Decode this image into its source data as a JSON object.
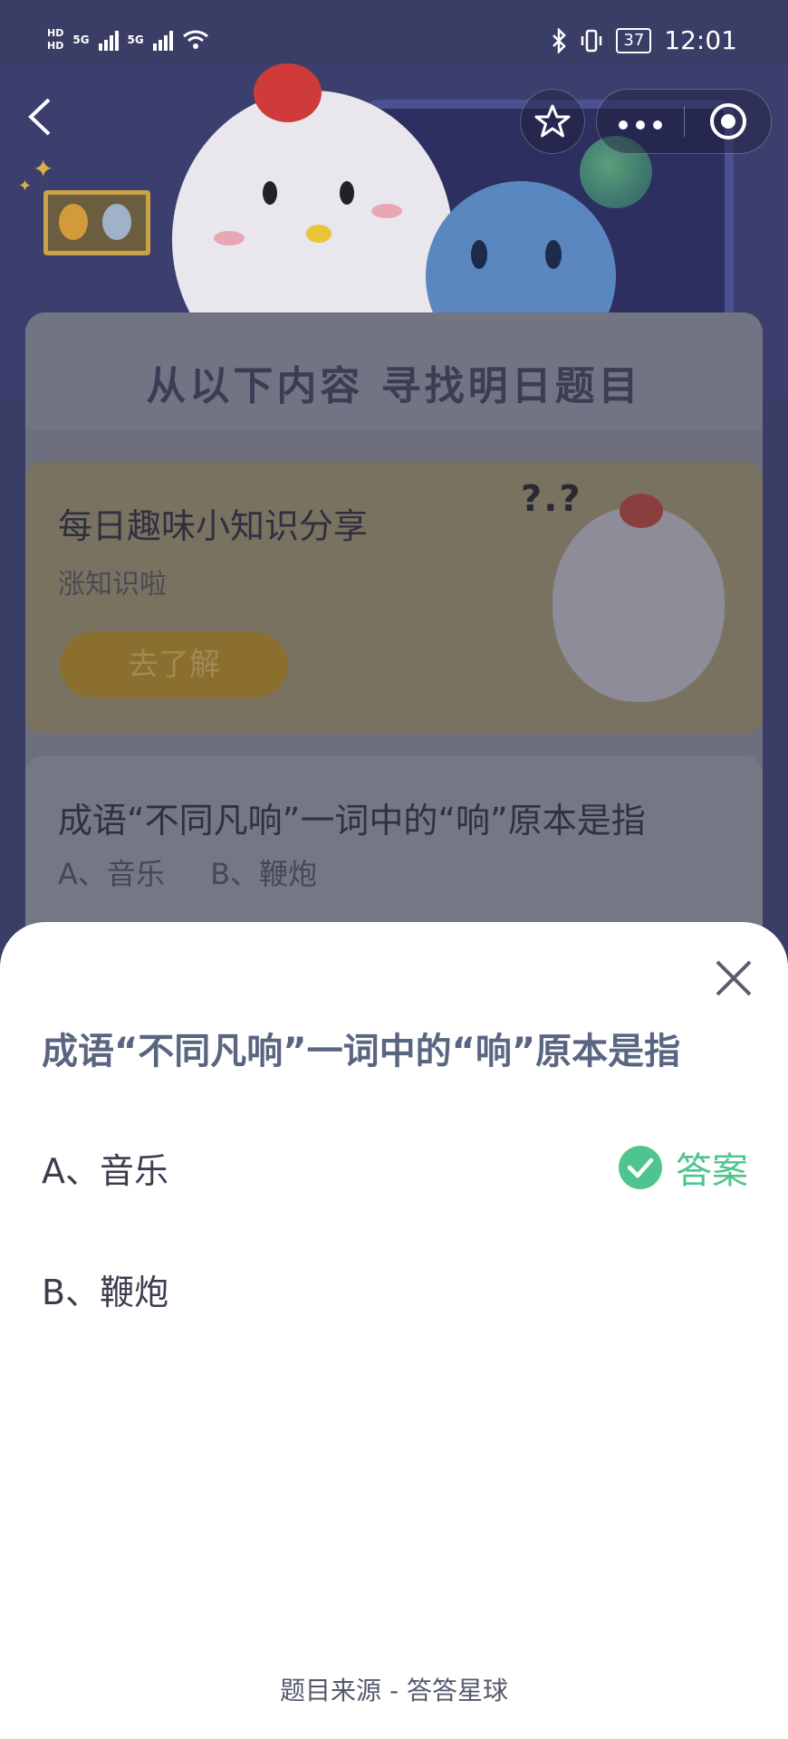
{
  "status_bar": {
    "hd1": "HD",
    "hd2": "HD",
    "network1": "5G",
    "network2": "5G",
    "battery": "37",
    "time": "12:01"
  },
  "background": {
    "heading": "从以下内容 寻找明日题目",
    "trivia_card": {
      "title": "每日趣味小知识分享",
      "subtitle": "涨知识啦",
      "button": "去了解"
    },
    "question_card": {
      "title": "成语“不同凡响”一词中的“响”原本是指",
      "options": [
        "A、音乐",
        "B、鞭炮"
      ]
    }
  },
  "sheet": {
    "question": "成语“不同凡响”一词中的“响”原本是指",
    "options": [
      {
        "label": "A、音乐",
        "is_answer": true
      },
      {
        "label": "B、鞭炮",
        "is_answer": false
      }
    ],
    "answer_label": "答案",
    "answer_color": "#4fc48e",
    "footer": "题目来源 - 答答星球"
  },
  "colors": {
    "sheet_title": "#5a6581",
    "background_overlay": "#3a3d66"
  }
}
